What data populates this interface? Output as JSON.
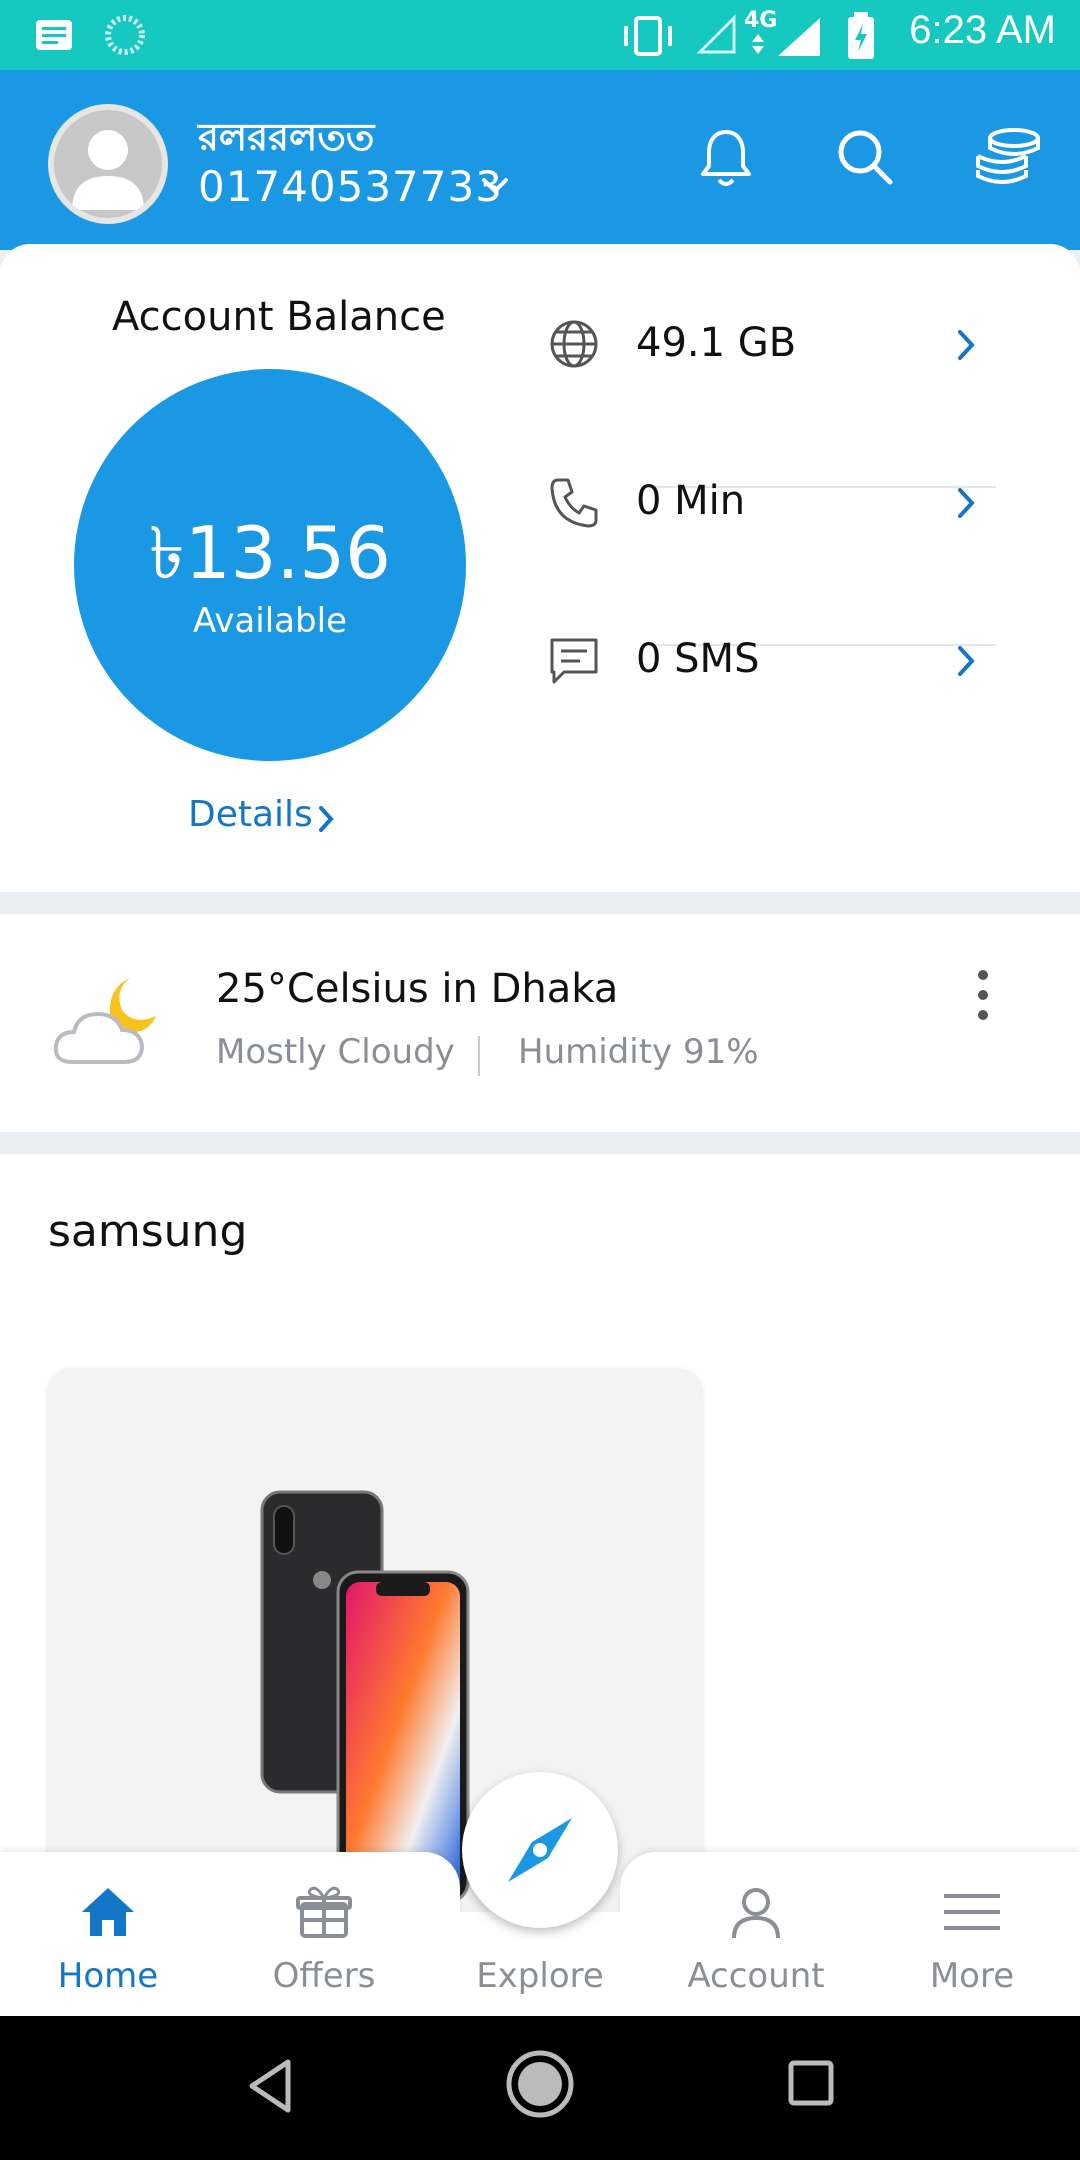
{
  "status_bar": {
    "time": "6:23 AM",
    "network": "4G"
  },
  "header": {
    "user_name": "রলররলতত",
    "phone": "01740537733"
  },
  "balance": {
    "title": "Account Balance",
    "amount": "৳13.56",
    "label": "Available",
    "details_label": "Details",
    "usage": [
      {
        "icon": "globe-icon",
        "value": "49.1 GB"
      },
      {
        "icon": "phone-icon",
        "value": "0 Min"
      },
      {
        "icon": "sms-icon",
        "value": "0 SMS"
      }
    ]
  },
  "weather": {
    "title": "25°Celsius in Dhaka",
    "condition": "Mostly Cloudy",
    "humidity": "Humidity 91%"
  },
  "section": {
    "title": "samsung"
  },
  "bottom_nav": {
    "items": [
      {
        "label": "Home",
        "icon": "home-icon",
        "active": true
      },
      {
        "label": "Offers",
        "icon": "gift-icon",
        "active": false
      },
      {
        "label": "Explore",
        "icon": "compass-icon",
        "active": false
      },
      {
        "label": "Account",
        "icon": "person-icon",
        "active": false
      },
      {
        "label": "More",
        "icon": "menu-icon",
        "active": false
      }
    ]
  },
  "colors": {
    "primary": "#1b98e3",
    "status_bar": "#16c9c0",
    "accent_link": "#1476c9"
  }
}
